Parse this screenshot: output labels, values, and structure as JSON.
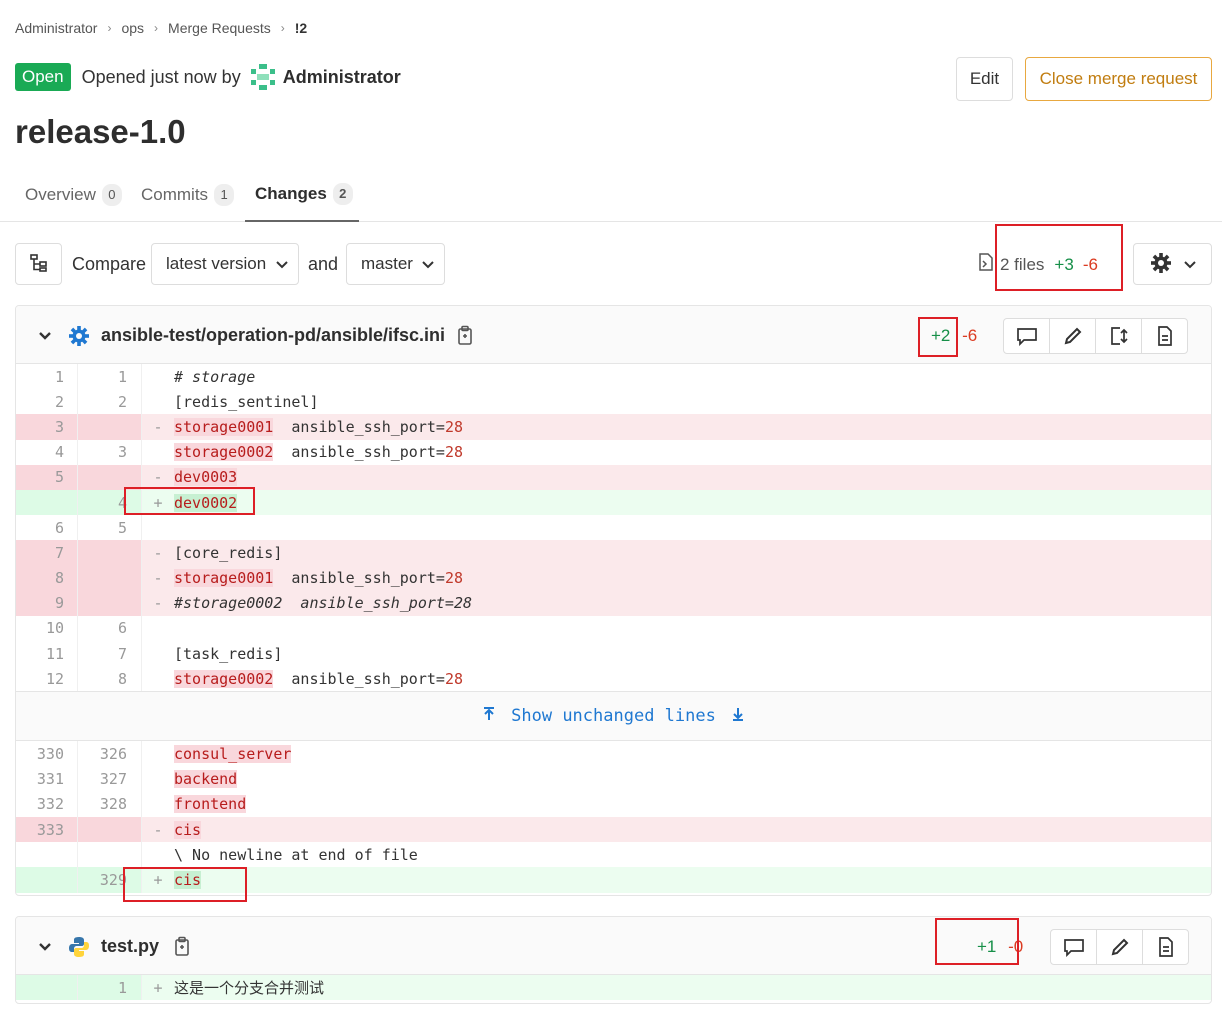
{
  "breadcrumb": [
    "Administrator",
    "ops",
    "Merge Requests",
    "!2"
  ],
  "header": {
    "status": "Open",
    "opened_text": "Opened just now by",
    "author": "Administrator",
    "edit_label": "Edit",
    "close_label": "Close merge request"
  },
  "title": "release-1.0",
  "tabs": [
    {
      "label": "Overview",
      "count": "0"
    },
    {
      "label": "Commits",
      "count": "1"
    },
    {
      "label": "Changes",
      "count": "2"
    }
  ],
  "compare": {
    "label": "Compare",
    "version": "latest version",
    "and": "and",
    "target": "master"
  },
  "summary": {
    "files": "2 files",
    "added": "+3",
    "removed": "-6"
  },
  "files": [
    {
      "path": "ansible-test/operation-pd/ansible/ifsc.ini",
      "added": "+2",
      "removed": "-6",
      "unchanged_label": "Show unchanged lines"
    },
    {
      "path": "test.py",
      "added": "+1",
      "removed": "-0",
      "line_text": "这是一个分支合并测试"
    }
  ],
  "colors": {
    "open": "#1aaa55",
    "added": "#168f48",
    "removed": "#db3b21",
    "close": "#c17d10",
    "link": "#1f78d1"
  }
}
